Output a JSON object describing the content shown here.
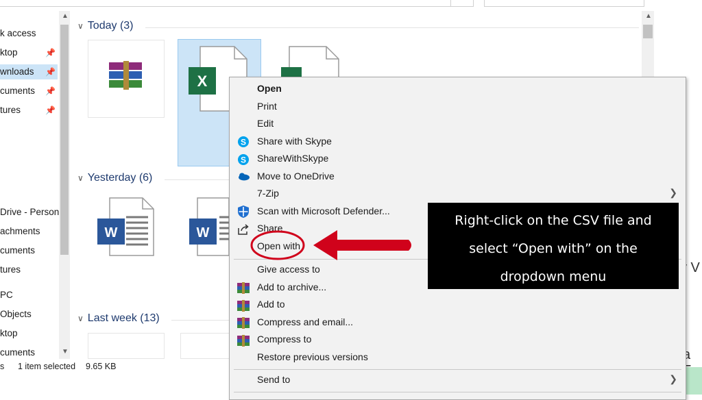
{
  "sidebar": {
    "items": [
      {
        "label": "k access",
        "pinned": false
      },
      {
        "label": "ktop",
        "pinned": true
      },
      {
        "label": "wnloads",
        "pinned": true
      },
      {
        "label": "cuments",
        "pinned": true
      },
      {
        "label": "tures",
        "pinned": true
      },
      {
        "label": "Drive - Persona",
        "pinned": false
      },
      {
        "label": "achments",
        "pinned": false
      },
      {
        "label": "cuments",
        "pinned": false
      },
      {
        "label": "tures",
        "pinned": false
      },
      {
        "label": "PC",
        "pinned": false
      },
      {
        "label": "Objects",
        "pinned": false
      },
      {
        "label": "ktop",
        "pinned": false
      },
      {
        "label": "cuments",
        "pinned": false
      }
    ]
  },
  "groups": {
    "today": "Today (3)",
    "yesterday": "Yesterday (6)",
    "last_week": "Last week (13)"
  },
  "status": {
    "count_fragment": "s",
    "selected": "1 item selected",
    "size": "9.65 KB"
  },
  "page": {
    "fragment_1": "y V",
    "fragment_2": "a F"
  },
  "menu": {
    "items": [
      {
        "label": "Open",
        "icon": "none",
        "bold": true
      },
      {
        "label": "Print",
        "icon": "none"
      },
      {
        "label": "Edit",
        "icon": "none"
      },
      {
        "label": "Share with Skype",
        "icon": "skype-icon"
      },
      {
        "label": "ShareWithSkype",
        "icon": "skype-icon"
      },
      {
        "label": "Move to OneDrive",
        "icon": "onedrive-icon"
      },
      {
        "label": "7-Zip",
        "icon": "none",
        "submenu": true
      },
      {
        "label": "Scan with Microsoft Defender...",
        "icon": "defender-icon"
      },
      {
        "label": "Share",
        "icon": "share-icon"
      },
      {
        "label": "Open with",
        "icon": "none"
      },
      {
        "label": "Give access to",
        "icon": "none"
      },
      {
        "label": "Add to archive...",
        "icon": "winrar-icon"
      },
      {
        "label": "Add to",
        "icon": "winrar-icon"
      },
      {
        "label": "Compress and email...",
        "icon": "winrar-icon"
      },
      {
        "label": "Compress to",
        "icon": "winrar-icon"
      },
      {
        "label": "Restore previous versions",
        "icon": "none"
      },
      {
        "label": "Send to",
        "icon": "none",
        "submenu": true
      }
    ]
  },
  "annotation": {
    "lines": [
      "Right-click on the CSV file and",
      "select “Open with” on the",
      "dropdown menu"
    ],
    "highlight_color": "#d0021b"
  },
  "colors": {
    "selection": "#cce4f7",
    "menu_bg": "#f2f2f2",
    "group_header": "#1e3a6e"
  }
}
